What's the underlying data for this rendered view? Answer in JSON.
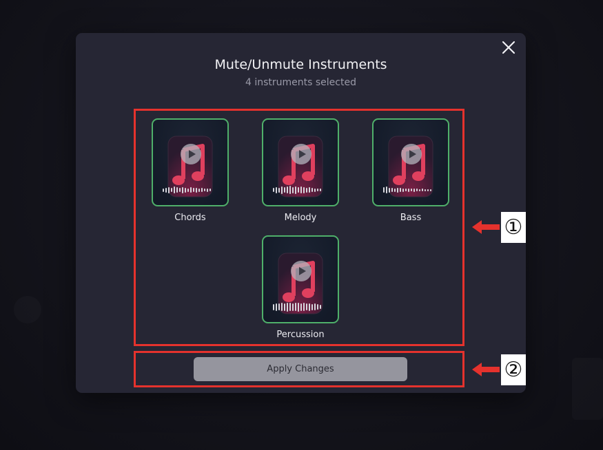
{
  "modal": {
    "title": "Mute/Unmute Instruments",
    "subtitle": "4 instruments selected",
    "close_icon": "close-icon",
    "apply_label": "Apply Changes"
  },
  "instruments": [
    {
      "label": "Chords",
      "selected": true
    },
    {
      "label": "Melody",
      "selected": true
    },
    {
      "label": "Bass",
      "selected": true
    },
    {
      "label": "Percussion",
      "selected": true
    }
  ],
  "annotations": [
    {
      "label": "①"
    },
    {
      "label": "②"
    }
  ],
  "colors": {
    "selected_border": "#4fb06a",
    "callout": "#e5322d",
    "note": "#e0405e",
    "modal_bg": "#262634",
    "button_bg": "#95959e"
  }
}
